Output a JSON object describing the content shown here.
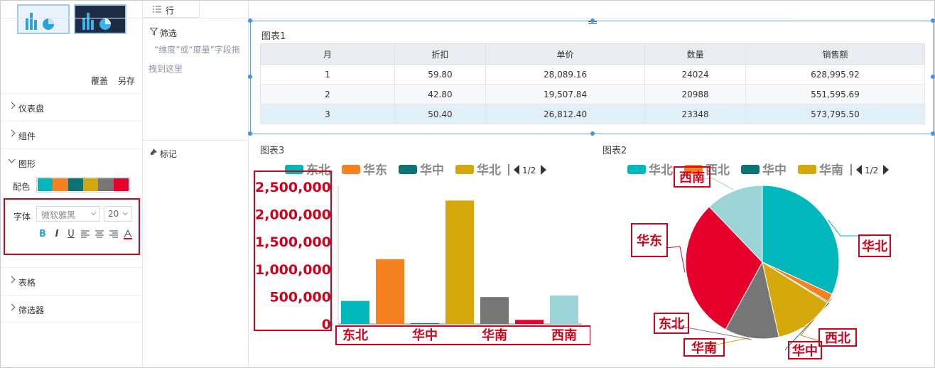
{
  "left": {
    "actions": {
      "overwrite": "覆盖",
      "save_as": "另存"
    },
    "sections": {
      "dashboard": "仪表盘",
      "component": "组件",
      "graphic": "图形",
      "table": "表格",
      "filter": "筛选器"
    },
    "color": {
      "label": "配色",
      "swatches": [
        "#00b8bc",
        "#f68121",
        "#0c7474",
        "#d4a70a",
        "#767676",
        "#e8002d"
      ]
    },
    "font": {
      "label": "字体",
      "family": "微软雅黑",
      "size": "20"
    },
    "format_buttons": [
      "B",
      "I",
      "U"
    ]
  },
  "middle": {
    "row_tab": "行",
    "filter": {
      "title": "筛选",
      "hint": "“维度”或“度量”字段拖拽到这里"
    },
    "marks": {
      "title": "标记"
    }
  },
  "chart_data": [
    {
      "type": "table",
      "title": "图表1",
      "columns": [
        "月",
        "折扣",
        "单价",
        "数量",
        "销售额"
      ],
      "rows": [
        [
          "1",
          "59.80",
          "28,089.16",
          "24024",
          "628,995.92"
        ],
        [
          "2",
          "42.80",
          "19,507.84",
          "20988",
          "551,595.69"
        ],
        [
          "3",
          "50.40",
          "26,812.40",
          "23348",
          "573,795.50"
        ]
      ]
    },
    {
      "type": "bar",
      "title": "图表3",
      "categories": [
        "东北",
        "华东",
        "华中",
        "华北",
        "华南",
        "西北",
        "西南"
      ],
      "values": [
        420000,
        1180000,
        15000,
        2250000,
        490000,
        75000,
        520000
      ],
      "colors": [
        "#00b8bc",
        "#f68121",
        "#0c7474",
        "#d4a70a",
        "#767676",
        "#e8002d",
        "#9cd3d7"
      ],
      "ylim": [
        0,
        2500000
      ],
      "yticks": [
        "0",
        "500,000",
        "1,000,000",
        "1,500,000",
        "2,000,000",
        "2,500,000"
      ],
      "xticks_shown": [
        "东北",
        "华中",
        "华南",
        "西南"
      ],
      "legend": [
        "东北",
        "华东",
        "华中",
        "华北"
      ],
      "legend_page": "1/2"
    },
    {
      "type": "pie",
      "title": "图表2",
      "categories": [
        "华北",
        "西北",
        "华中",
        "华南",
        "东北",
        "华东",
        "西南"
      ],
      "values": [
        628996,
        35000,
        5000,
        250000,
        226000,
        590000,
        240000
      ],
      "colors": [
        "#00b8bc",
        "#f68121",
        "#0c7474",
        "#d4a70a",
        "#767676",
        "#e8002d",
        "#9cd3d7"
      ],
      "legend": [
        "华北",
        "西北",
        "华中",
        "华南"
      ],
      "legend_page": "1/2"
    }
  ]
}
